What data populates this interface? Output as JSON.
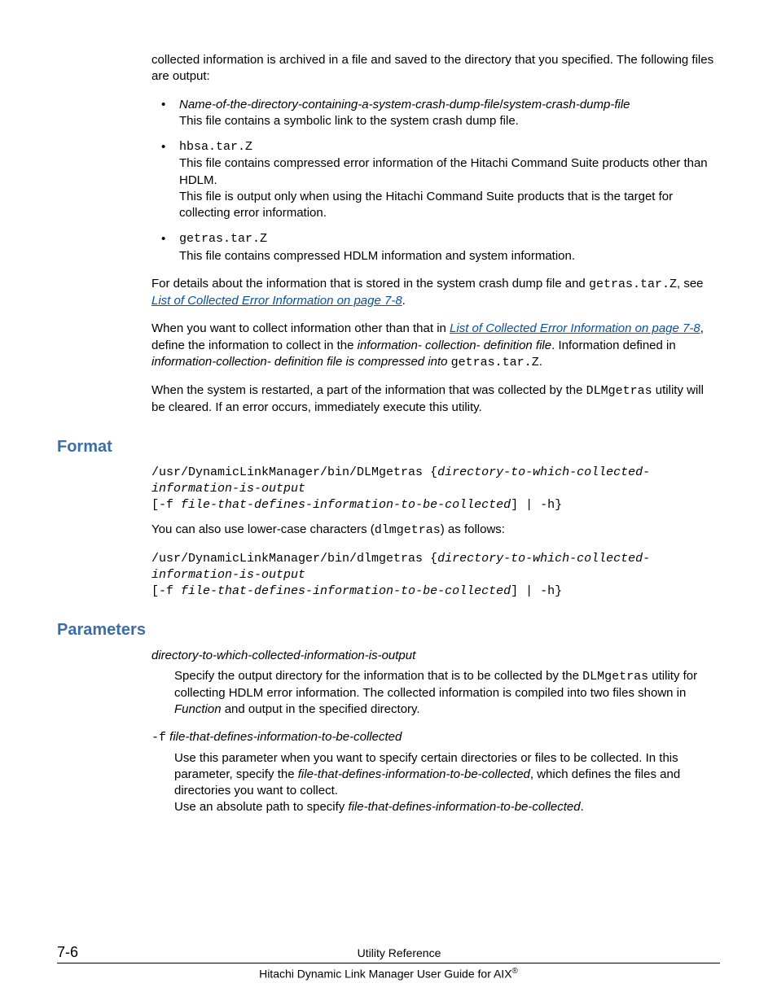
{
  "intro": "collected information is archived in a file and saved to the directory that you specified. The following files are output:",
  "bullets": [
    {
      "title_pre": "Name-of-the-directory-containing-a-system-crash-dump-file",
      "title_sep": "/",
      "title_post": "system-crash-dump-file",
      "lines": [
        "This file contains a symbolic link to the system crash dump file."
      ]
    },
    {
      "code_title": "hbsa.tar.Z",
      "lines": [
        "This file contains compressed error information of the Hitachi Command Suite products other than HDLM.",
        "This file is output only when using the Hitachi Command Suite products that is the target for collecting error information."
      ]
    },
    {
      "code_title": "getras.tar.Z",
      "lines": [
        "This file contains compressed HDLM information and system information."
      ]
    }
  ],
  "details": {
    "pre": "For details about the information that is stored in the system crash dump file and ",
    "code": "getras.tar.Z",
    "mid": ", see ",
    "link": "List of Collected Error Information on page 7-8",
    "post": "."
  },
  "collect_other": {
    "pre": "When you want to collect information other than that in ",
    "link": "List of Collected Error Information on page 7-8",
    "mid1": ", define the information to collect in the ",
    "em1": "information- collection- definition file",
    "mid2": ". Information defined in ",
    "em2": "information-collection- definition file is compressed into ",
    "code": "getras.tar.Z",
    "post": "."
  },
  "restart": {
    "pre": "When the system is restarted, a part of the information that was collected by the ",
    "code": "DLMgetras",
    "post": " utility will be cleared. If an error occurs, immediately execute this utility."
  },
  "format": {
    "heading": "Format",
    "cmd1_a": "/usr/DynamicLinkManager/bin/DLMgetras {",
    "cmd1_b": "directory-to-which-collected-information-is-output",
    "cmd1_c": "\n[-f ",
    "cmd1_d": "file-that-defines-information-to-be-collected",
    "cmd1_e": "] | -h}",
    "lower_pre": "You can also use lower-case characters (",
    "lower_code": "dlmgetras",
    "lower_post": ") as follows:",
    "cmd2_a": "/usr/DynamicLinkManager/bin/dlmgetras {",
    "cmd2_b": "directory-to-which-collected-information-is-output",
    "cmd2_c": "\n[-f ",
    "cmd2_d": "file-that-defines-information-to-be-collected",
    "cmd2_e": "] | -h}"
  },
  "params": {
    "heading": "Parameters",
    "p1_dt": "directory-to-which-collected-information-is-output",
    "p1_dd_pre": "Specify the output directory for the information that is to be collected by the ",
    "p1_dd_code": "DLMgetras",
    "p1_dd_mid": " utility for collecting HDLM error information. The collected information is compiled into two files shown in ",
    "p1_dd_em": "Function",
    "p1_dd_post": " and output in the specified directory.",
    "p2_dt_code": "-f",
    "p2_dt_em": " file-that-defines-information-to-be-collected",
    "p2_dd1_pre": "Use this parameter when you want to specify certain directories or files to be collected. In this parameter, specify the ",
    "p2_dd1_em": "file-that-defines-information-to-be-collected",
    "p2_dd1_post": ", which defines the files and directories you want to collect.",
    "p2_dd2_pre": "Use an absolute path to specify ",
    "p2_dd2_em": "file-that-defines-information-to-be-collected",
    "p2_dd2_post": "."
  },
  "footer": {
    "page": "7-6",
    "title": "Utility Reference",
    "sub_pre": "Hitachi Dynamic Link Manager User Guide for AIX",
    "sub_reg": "®"
  }
}
